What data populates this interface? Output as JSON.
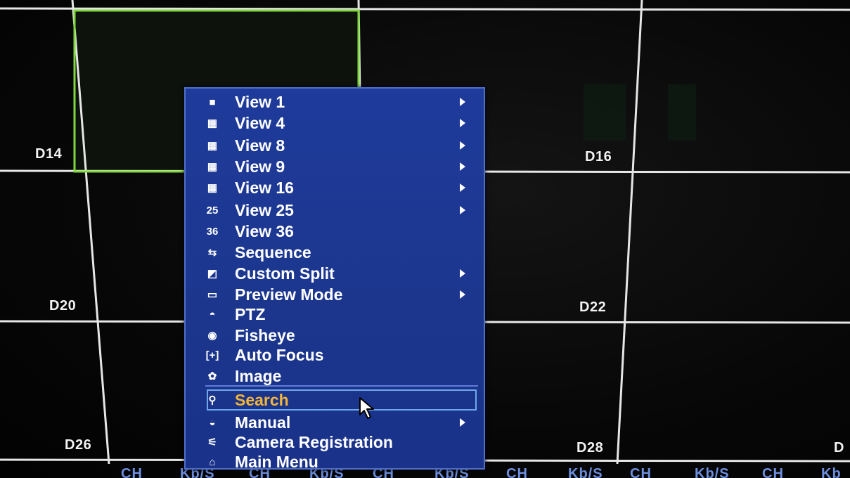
{
  "tiles": {
    "d14": "D14",
    "d16": "D16",
    "d20": "D20",
    "d22": "D22",
    "d26": "D26",
    "d28": "D28",
    "edge": "D"
  },
  "status_bar": [
    "CH",
    "Kb/S",
    "CH",
    "Kb/S",
    "CH",
    "Kb/S",
    "CH",
    "Kb/S",
    "CH",
    "Kb/S",
    "CH",
    "Kb"
  ],
  "colors": {
    "menu_background": "#1c378f",
    "menu_border": "#4f6fc8",
    "selected_text": "#f2b53a",
    "selected_border": "#6fa8e8",
    "active_tile_border": "#7fd93a",
    "grid_lines": "#e6e6e6"
  },
  "menu": {
    "items": [
      {
        "label": "View 1",
        "icon": "single-window-icon",
        "glyph": "■",
        "submenu": true
      },
      {
        "label": "View 4",
        "icon": "four-grid-icon",
        "glyph": "▦",
        "submenu": true
      },
      {
        "label": "View 8",
        "icon": "eight-grid-icon",
        "glyph": "▦",
        "submenu": true
      },
      {
        "label": "View 9",
        "icon": "nine-grid-icon",
        "glyph": "▦",
        "submenu": true
      },
      {
        "label": "View 16",
        "icon": "sixteen-grid-icon",
        "glyph": "▦",
        "submenu": true
      },
      {
        "label": "View 25",
        "icon": "twenty-five-grid-icon",
        "glyph": "25",
        "submenu": true
      },
      {
        "label": "View 36",
        "icon": "thirty-six-grid-icon",
        "glyph": "36",
        "submenu": false
      },
      {
        "label": "Sequence",
        "icon": "sequence-icon",
        "glyph": "⇆",
        "submenu": false
      },
      {
        "label": "Custom Split",
        "icon": "custom-split-icon",
        "glyph": "◩",
        "submenu": true
      },
      {
        "label": "Preview Mode",
        "icon": "monitor-icon",
        "glyph": "▭",
        "submenu": true
      },
      {
        "label": "PTZ",
        "icon": "dome-camera-icon",
        "glyph": "◓",
        "submenu": false
      },
      {
        "label": "Fisheye",
        "icon": "fisheye-icon",
        "glyph": "◉",
        "submenu": false
      },
      {
        "label": "Auto Focus",
        "icon": "auto-focus-icon",
        "glyph": "[+]",
        "submenu": false
      },
      {
        "label": "Image",
        "icon": "palette-icon",
        "glyph": "✿",
        "submenu": false
      },
      {
        "label": "Search",
        "icon": "search-icon",
        "glyph": "⚲",
        "submenu": false,
        "selected": true
      },
      {
        "label": "Manual",
        "icon": "manual-icon",
        "glyph": "◒",
        "submenu": true
      },
      {
        "label": "Camera Registration",
        "icon": "camera-registration-icon",
        "glyph": "⚟",
        "submenu": false
      },
      {
        "label": "Main Menu",
        "icon": "home-icon",
        "glyph": "⌂",
        "submenu": false
      }
    ]
  }
}
